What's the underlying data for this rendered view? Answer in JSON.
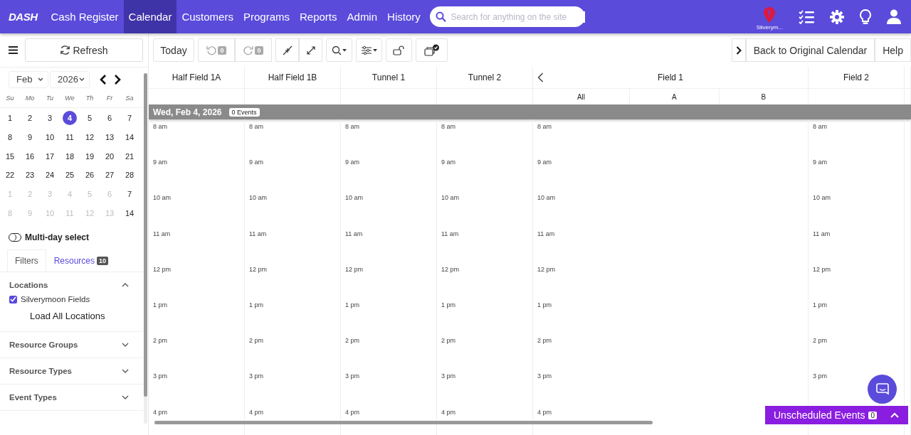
{
  "nav": {
    "logo": "DASH",
    "items": [
      {
        "label": "Cash Register",
        "selected": false
      },
      {
        "label": "Calendar",
        "selected": true
      },
      {
        "label": "Customers",
        "selected": false
      },
      {
        "label": "Programs",
        "selected": false
      },
      {
        "label": "Reports",
        "selected": false
      },
      {
        "label": "Admin",
        "selected": false
      },
      {
        "label": "History",
        "selected": false
      }
    ],
    "search": {
      "placeholder": "Search for anything on the site"
    },
    "location": "Silverym..."
  },
  "toolbar": {
    "refresh": "Refresh",
    "today": "Today",
    "undo_count": "0",
    "redo_count": "0",
    "back": "Back to Original Calendar",
    "help": "Help"
  },
  "mini_calendar": {
    "month": "Feb",
    "year": "2026",
    "weekdays": [
      "Su",
      "Mo",
      "Tu",
      "We",
      "Th",
      "Fr",
      "Sa"
    ],
    "weeks": [
      [
        {
          "day": "1",
          "muted": false,
          "selected": false
        },
        {
          "day": "2",
          "muted": false,
          "selected": false
        },
        {
          "day": "3",
          "muted": false,
          "selected": false
        },
        {
          "day": "4",
          "muted": false,
          "selected": true
        },
        {
          "day": "5",
          "muted": false,
          "selected": false
        },
        {
          "day": "6",
          "muted": false,
          "selected": false
        },
        {
          "day": "7",
          "muted": false,
          "selected": false
        }
      ],
      [
        {
          "day": "8",
          "muted": false,
          "selected": false
        },
        {
          "day": "9",
          "muted": false,
          "selected": false
        },
        {
          "day": "10",
          "muted": false,
          "selected": false
        },
        {
          "day": "11",
          "muted": false,
          "selected": false
        },
        {
          "day": "12",
          "muted": false,
          "selected": false
        },
        {
          "day": "13",
          "muted": false,
          "selected": false
        },
        {
          "day": "14",
          "muted": false,
          "selected": false
        }
      ],
      [
        {
          "day": "15",
          "muted": false,
          "selected": false
        },
        {
          "day": "16",
          "muted": false,
          "selected": false
        },
        {
          "day": "17",
          "muted": false,
          "selected": false
        },
        {
          "day": "18",
          "muted": false,
          "selected": false
        },
        {
          "day": "19",
          "muted": false,
          "selected": false
        },
        {
          "day": "20",
          "muted": false,
          "selected": false
        },
        {
          "day": "21",
          "muted": false,
          "selected": false
        }
      ],
      [
        {
          "day": "22",
          "muted": false,
          "selected": false
        },
        {
          "day": "23",
          "muted": false,
          "selected": false
        },
        {
          "day": "24",
          "muted": false,
          "selected": false
        },
        {
          "day": "25",
          "muted": false,
          "selected": false
        },
        {
          "day": "26",
          "muted": false,
          "selected": false
        },
        {
          "day": "27",
          "muted": false,
          "selected": false
        },
        {
          "day": "28",
          "muted": false,
          "selected": false
        }
      ],
      [
        {
          "day": "1",
          "muted": true,
          "selected": false
        },
        {
          "day": "2",
          "muted": true,
          "selected": false
        },
        {
          "day": "3",
          "muted": true,
          "selected": false
        },
        {
          "day": "4",
          "muted": true,
          "selected": false
        },
        {
          "day": "5",
          "muted": true,
          "selected": false
        },
        {
          "day": "6",
          "muted": true,
          "selected": false
        },
        {
          "day": "7",
          "muted": false,
          "selected": false
        }
      ],
      [
        {
          "day": "8",
          "muted": true,
          "selected": false
        },
        {
          "day": "9",
          "muted": true,
          "selected": false
        },
        {
          "day": "10",
          "muted": true,
          "selected": false
        },
        {
          "day": "11",
          "muted": true,
          "selected": false
        },
        {
          "day": "12",
          "muted": true,
          "selected": false
        },
        {
          "day": "13",
          "muted": true,
          "selected": false
        },
        {
          "day": "14",
          "muted": false,
          "selected": false
        }
      ]
    ]
  },
  "multi_day": {
    "label": "Multi-day select",
    "on": false
  },
  "tabs": [
    {
      "label": "Filters",
      "selected": true
    },
    {
      "label": "Resources",
      "badge": "10",
      "selected": false
    }
  ],
  "filters": [
    {
      "title": "Locations",
      "expanded": true,
      "options": [
        {
          "label": "Silverymoon Fields",
          "checked": true
        }
      ],
      "action": "Load All Locations"
    },
    {
      "title": "Resource Groups",
      "expanded": false
    },
    {
      "title": "Resource Types",
      "expanded": false
    },
    {
      "title": "Event Types",
      "expanded": false
    }
  ],
  "schedule": {
    "date": "Wed, Feb 4, 2026",
    "events_badge": "0 Events",
    "columns": [
      {
        "name": "Half Field 1A",
        "prev_button": false,
        "times": [
          "8 am",
          "9 am",
          "10 am",
          "11 am",
          "12 pm",
          "1 pm",
          "2 pm",
          "3 pm",
          "4 pm"
        ]
      },
      {
        "name": "Half Field 1B",
        "prev_button": false,
        "times": [
          "8 am",
          "9 am",
          "10 am",
          "11 am",
          "12 pm",
          "1 pm",
          "2 pm",
          "3 pm",
          "4 pm"
        ]
      },
      {
        "name": "Tunnel 1",
        "prev_button": false,
        "times": [
          "8 am",
          "9 am",
          "10 am",
          "11 am",
          "12 pm",
          "1 pm",
          "2 pm",
          "3 pm",
          "4 pm"
        ]
      },
      {
        "name": "Tunnel 2",
        "prev_button": false,
        "times": [
          "8 am",
          "9 am",
          "10 am",
          "11 am",
          "12 pm",
          "1 pm",
          "2 pm",
          "3 pm",
          "4 pm"
        ]
      },
      {
        "name": "Field 1",
        "prev_button": true,
        "subcolumns": [
          "All",
          "A",
          "B"
        ],
        "times": [
          "8 am",
          "9 am",
          "10 am",
          "11 am",
          "12 pm",
          "1 pm",
          "2 pm",
          "3 pm",
          "4 pm"
        ]
      },
      {
        "name": "Field 2",
        "prev_button": false,
        "times": [
          "8 am",
          "9 am",
          "10 am",
          "11 am",
          "12 pm",
          "1 pm",
          "2 pm",
          "3 pm"
        ]
      }
    ]
  },
  "unscheduled": {
    "label": "Unscheduled Events",
    "count": "0"
  }
}
